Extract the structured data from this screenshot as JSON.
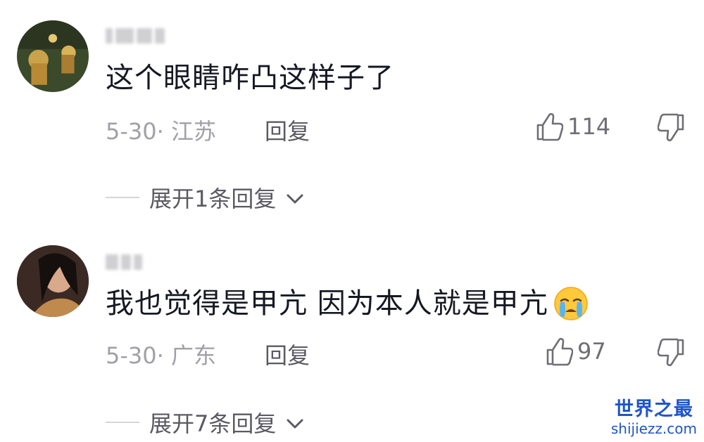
{
  "comments": [
    {
      "text": "这个眼睛咋凸这样子了",
      "meta": "5-30· 江苏",
      "reply_label": "回复",
      "likes": "114",
      "expand_label": "展开1条回复"
    },
    {
      "text": "我也觉得是甲亢 因为本人就是甲亢",
      "meta": "5-30· 广东",
      "reply_label": "回复",
      "likes": "97",
      "expand_label": "展开7条回复"
    }
  ],
  "icons": {
    "like": "thumbs-up-icon",
    "dislike": "thumbs-down-icon",
    "expand": "chevron-down-icon",
    "emoji": "crying-face-icon"
  },
  "watermark": {
    "title": "世界之最",
    "url": "shijiezz.com"
  }
}
